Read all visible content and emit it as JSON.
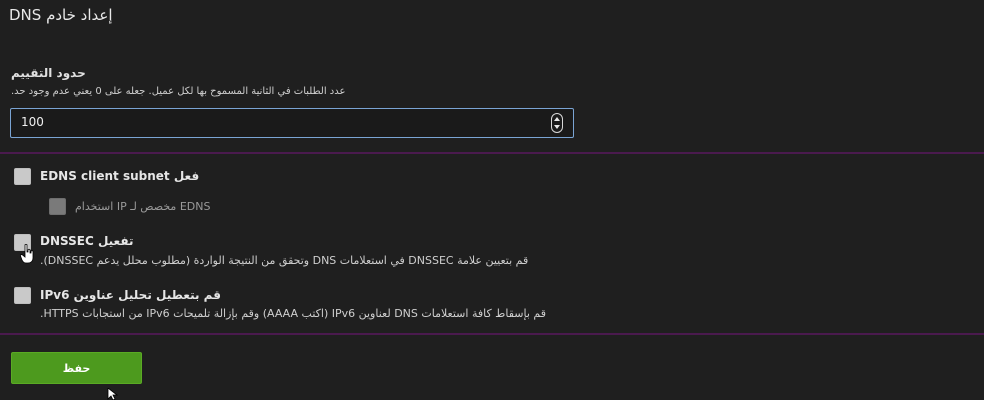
{
  "page": {
    "title": "إعداد خادم DNS"
  },
  "rate_limit": {
    "label": "حدود التقييم",
    "description": "عدد الطلبات في الثانية المسموح بها لكل عميل. جعله على 0 يعني عدم وجود حد.",
    "value": "100"
  },
  "options": {
    "edns": {
      "label": "فعل EDNS client subnet",
      "sub_label": "EDNS مخصص لـ IP استخدام"
    },
    "dnssec": {
      "label": "تفعيل DNSSEC",
      "description": "قم بتعيين علامة DNSSEC في استعلامات DNS وتحقق من النتيجة الواردة (مطلوب محلل يدعم DNSSEC)."
    },
    "ipv6": {
      "label": "قم بتعطيل تحليل عناوين IPv6",
      "description": "قم بإسقاط كافة استعلامات DNS لعناوين IPv6 (اكتب AAAA) وقم بإزالة تلميحات IPv6 من استجابات HTTPS."
    }
  },
  "actions": {
    "save_label": "حفظ"
  },
  "colors": {
    "background": "#1f1f1f",
    "divider": "#4a1a4e",
    "save_button": "#4d9a1e",
    "input_border": "#7aa4d4"
  }
}
